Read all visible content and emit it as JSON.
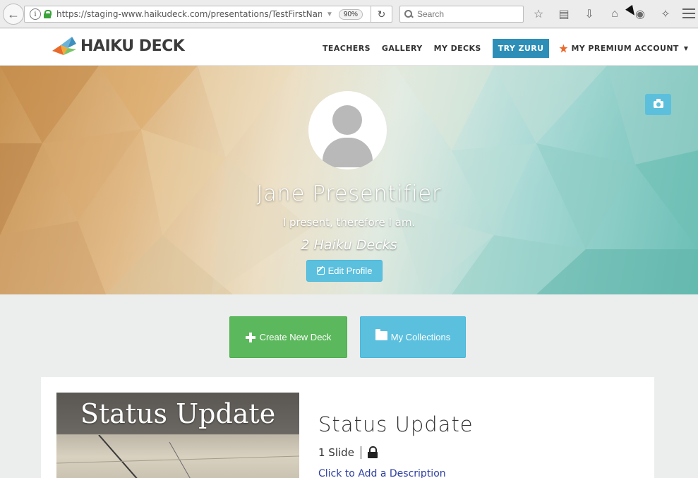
{
  "browser": {
    "url": "https://staging-www.haikudeck.com/presentations/TestFirstName",
    "zoom": "90%",
    "search_placeholder": "Search"
  },
  "header": {
    "logo_text": "HAIKU DECK",
    "nav": {
      "teachers": "TEACHERS",
      "gallery": "GALLERY",
      "my_decks": "MY DECKS",
      "try_zuru": "TRY ZURU",
      "premium": "MY PREMIUM ACCOUNT"
    }
  },
  "profile": {
    "name": "Jane Presentifier",
    "tagline": "I present, therefore I am.",
    "deck_count": "2 Haiku Decks",
    "edit_label": "Edit Profile"
  },
  "actions": {
    "create_label": "Create New Deck",
    "collections_label": "My Collections"
  },
  "deck": {
    "thumbnail_title": "Status Update",
    "title": "Status Update",
    "slides": "1 Slide",
    "description_link": "Click to Add a Description"
  },
  "colors": {
    "try_zuru_bg": "#2d8fb8",
    "create_button": "#5cb85c",
    "collections_button": "#5bc0de",
    "description_link": "#2c3e9f"
  }
}
